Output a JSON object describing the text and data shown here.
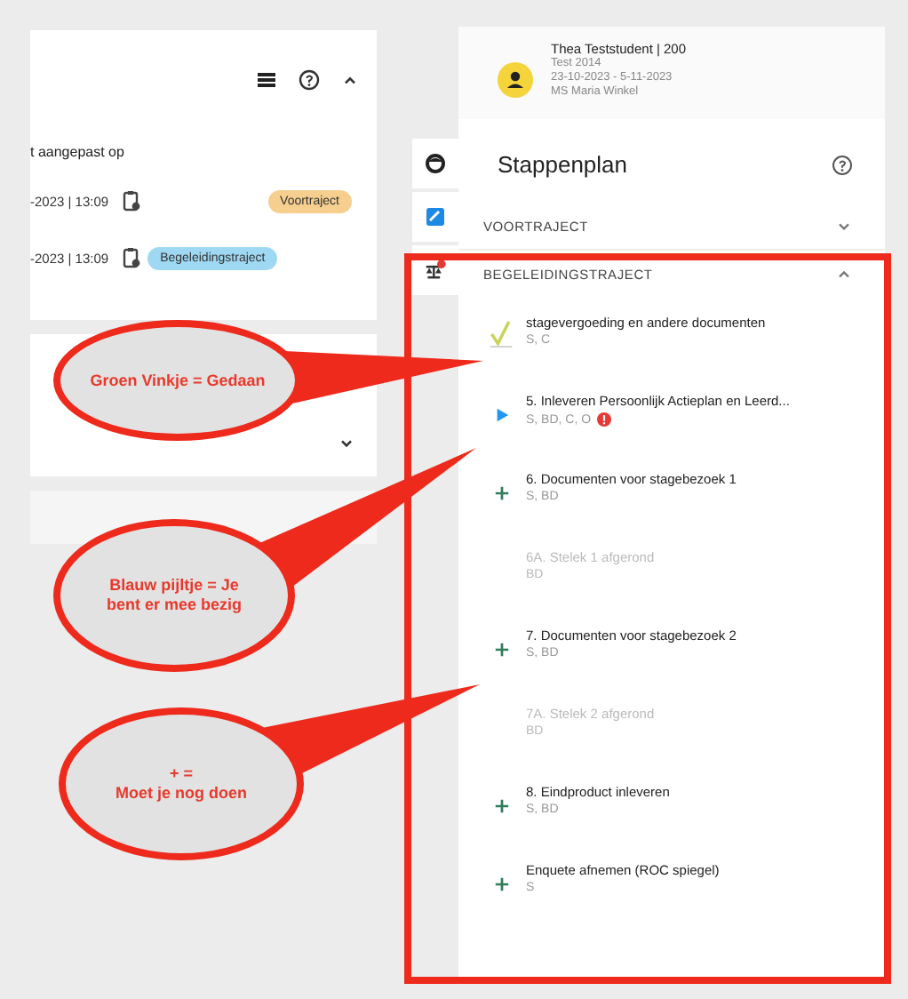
{
  "left_card": {
    "expanded": true,
    "updated_label": "t aangepast op",
    "rows": [
      {
        "date": "-2023 | 13:09",
        "tag": "Voortraject",
        "color": "#f6cf8e"
      },
      {
        "date": "-2023 | 13:09",
        "tag": "Begeleidingstraject",
        "color": "#9fd8f3"
      }
    ]
  },
  "left_card_2": {
    "expanded": false
  },
  "student": {
    "name": "Thea Teststudent | 200",
    "lines": [
      "Test 2014",
      "23-10-2023 - 5-11-2023",
      "MS Maria Winkel"
    ]
  },
  "stappenplan": {
    "title": "Stappenplan",
    "sections": [
      {
        "label": "VOORTRAJECT",
        "expanded": false
      },
      {
        "label": "BEGELEIDINGSTRAJECT",
        "expanded": true
      }
    ],
    "steps": [
      {
        "kind": "done",
        "title": "stagevergoeding en andere documenten",
        "roles": "S, C",
        "alert": false
      },
      {
        "kind": "active",
        "title": "5. Inleveren Persoonlijk Actieplan en Leerd...",
        "roles": "S, BD, C, O",
        "alert": true
      },
      {
        "kind": "todo",
        "title": "6. Documenten voor stagebezoek 1",
        "roles": "S, BD",
        "alert": false
      },
      {
        "kind": "disabled",
        "title": "6A. Stelek 1 afgerond",
        "roles": "BD",
        "alert": false
      },
      {
        "kind": "todo",
        "title": "7. Documenten voor stagebezoek 2",
        "roles": "S, BD",
        "alert": false
      },
      {
        "kind": "disabled",
        "title": "7A. Stelek 2 afgerond",
        "roles": "BD",
        "alert": false
      },
      {
        "kind": "todo",
        "title": "8. Eindproduct inleveren",
        "roles": "S, BD",
        "alert": false
      },
      {
        "kind": "todo",
        "title": "Enquete afnemen (ROC spiegel)",
        "roles": "S",
        "alert": false
      }
    ]
  },
  "callouts": [
    {
      "lines": [
        "Groen Vinkje = Gedaan"
      ]
    },
    {
      "lines": [
        "Blauw pijltje = Je",
        "bent er mee bezig"
      ]
    },
    {
      "lines": [
        "+ =",
        "Moet je nog doen"
      ]
    }
  ]
}
